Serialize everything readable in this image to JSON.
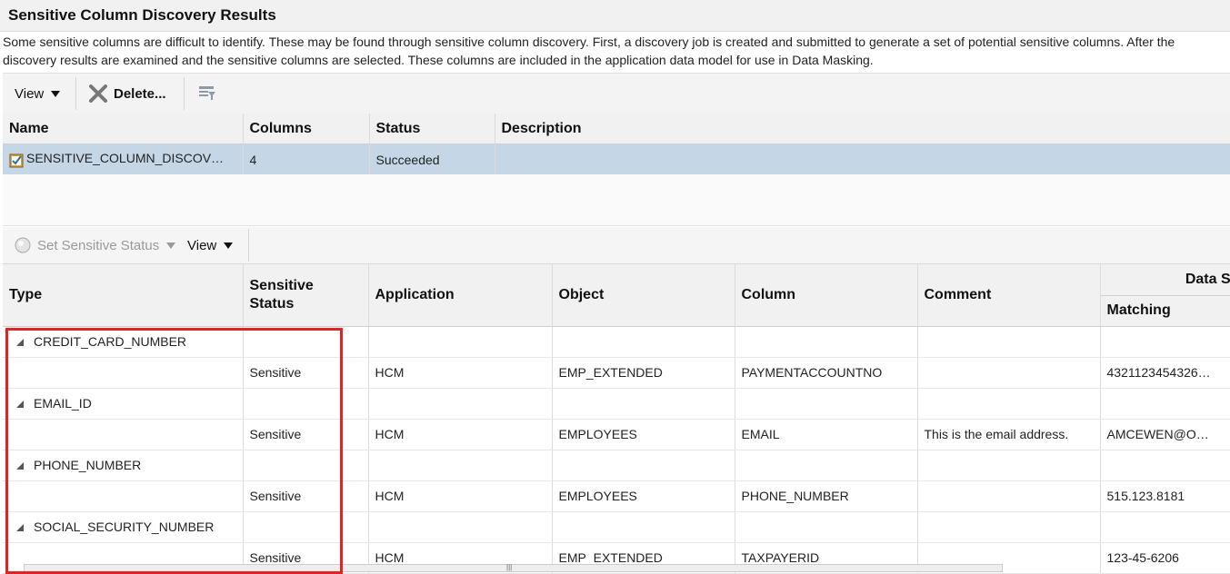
{
  "title": "Sensitive Column Discovery Results",
  "description": {
    "line1": "Some sensitive columns are difficult to identify. These may be found through sensitive column discovery. First, a discovery job is created and submitted to generate a set of potential sensitive columns. After the",
    "line2": "discovery results are examined and the sensitive columns are selected. These columns are included in the application data model for use in Data Masking."
  },
  "toolbar": {
    "view_label": "View",
    "delete_label": "Delete..."
  },
  "jobs_table": {
    "headers": [
      "Name",
      "Columns",
      "Status",
      "Description"
    ],
    "rows": [
      {
        "name": "SENSITIVE_COLUMN_DISCOV…",
        "columns": "4",
        "status": "Succeeded",
        "description": ""
      }
    ]
  },
  "toolbar2": {
    "set_status_label": "Set Sensitive Status",
    "view_label": "View"
  },
  "results_table": {
    "headers": {
      "type": "Type",
      "sensitive_status_1": "Sensitive",
      "sensitive_status_2": "Status",
      "application": "Application",
      "object": "Object",
      "column": "Column",
      "comment": "Comment",
      "data_sample_group": "Data Sa",
      "matching": "Matching"
    },
    "groups": [
      {
        "type": "CREDIT_CARD_NUMBER",
        "detail": {
          "status": "Sensitive",
          "application": "HCM",
          "object": "EMP_EXTENDED",
          "column": "PAYMENTACCOUNTNO",
          "comment": "",
          "matching": "4321123454326…"
        }
      },
      {
        "type": "EMAIL_ID",
        "detail": {
          "status": "Sensitive",
          "application": "HCM",
          "object": "EMPLOYEES",
          "column": "EMAIL",
          "comment": "This is the email address.",
          "matching": "AMCEWEN@O…"
        }
      },
      {
        "type": "PHONE_NUMBER",
        "detail": {
          "status": "Sensitive",
          "application": "HCM",
          "object": "EMPLOYEES",
          "column": "PHONE_NUMBER",
          "comment": "",
          "matching": "515.123.8181"
        }
      },
      {
        "type": "SOCIAL_SECURITY_NUMBER",
        "detail": {
          "status": "Sensitive",
          "application": "HCM",
          "object": "EMP_EXTENDED",
          "column": "TAXPAYERID",
          "comment": "",
          "matching": "123-45-6206"
        }
      }
    ]
  },
  "icons": {
    "view_dropdown": "chevron-down-icon",
    "delete": "close-x-icon",
    "filter": "query-filter-icon",
    "job": "checklist-icon",
    "status_radio": "radio-icon",
    "expand": "collapse-triangle-icon"
  },
  "colors": {
    "selected_row": "#c5d7e6",
    "highlight_box": "#e02424"
  }
}
